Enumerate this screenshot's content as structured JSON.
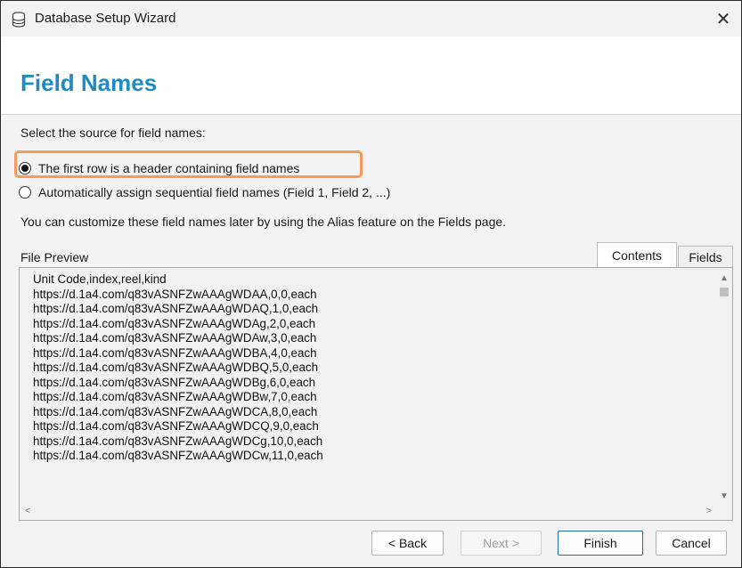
{
  "window": {
    "title": "Database Setup Wizard",
    "close_glyph": "✕"
  },
  "header": {
    "title": "Field Names"
  },
  "source": {
    "prompt": "Select the source for field names:",
    "options": [
      {
        "label": "The first row is a header containing field names",
        "selected": true
      },
      {
        "label": "Automatically assign sequential field names (Field 1, Field 2, ...)",
        "selected": false
      }
    ],
    "hint": "You can customize these field names later by using the Alias feature on the Fields page."
  },
  "preview": {
    "label": "File Preview",
    "tabs": [
      {
        "label": "Contents",
        "active": true
      },
      {
        "label": "Fields",
        "active": false
      }
    ],
    "lines": [
      "Unit Code,index,reel,kind",
      "https://d.1a4.com/q83vASNFZwAAAgWDAA,0,0,each",
      "https://d.1a4.com/q83vASNFZwAAAgWDAQ,1,0,each",
      "https://d.1a4.com/q83vASNFZwAAAgWDAg,2,0,each",
      "https://d.1a4.com/q83vASNFZwAAAgWDAw,3,0,each",
      "https://d.1a4.com/q83vASNFZwAAAgWDBA,4,0,each",
      "https://d.1a4.com/q83vASNFZwAAAgWDBQ,5,0,each",
      "https://d.1a4.com/q83vASNFZwAAAgWDBg,6,0,each",
      "https://d.1a4.com/q83vASNFZwAAAgWDBw,7,0,each",
      "https://d.1a4.com/q83vASNFZwAAAgWDCA,8,0,each",
      "https://d.1a4.com/q83vASNFZwAAAgWDCQ,9,0,each",
      "https://d.1a4.com/q83vASNFZwAAAgWDCg,10,0,each",
      "https://d.1a4.com/q83vASNFZwAAAgWDCw,11,0,each"
    ]
  },
  "buttons": {
    "back": "< Back",
    "next": "Next >",
    "finish": "Finish",
    "cancel": "Cancel"
  },
  "colors": {
    "title_blue": "#1d8cc4",
    "highlight_orange": "#f79a5c",
    "default_button_border": "#1d6fb8"
  },
  "icons": {
    "app": "database-icon",
    "close": "close-icon"
  }
}
